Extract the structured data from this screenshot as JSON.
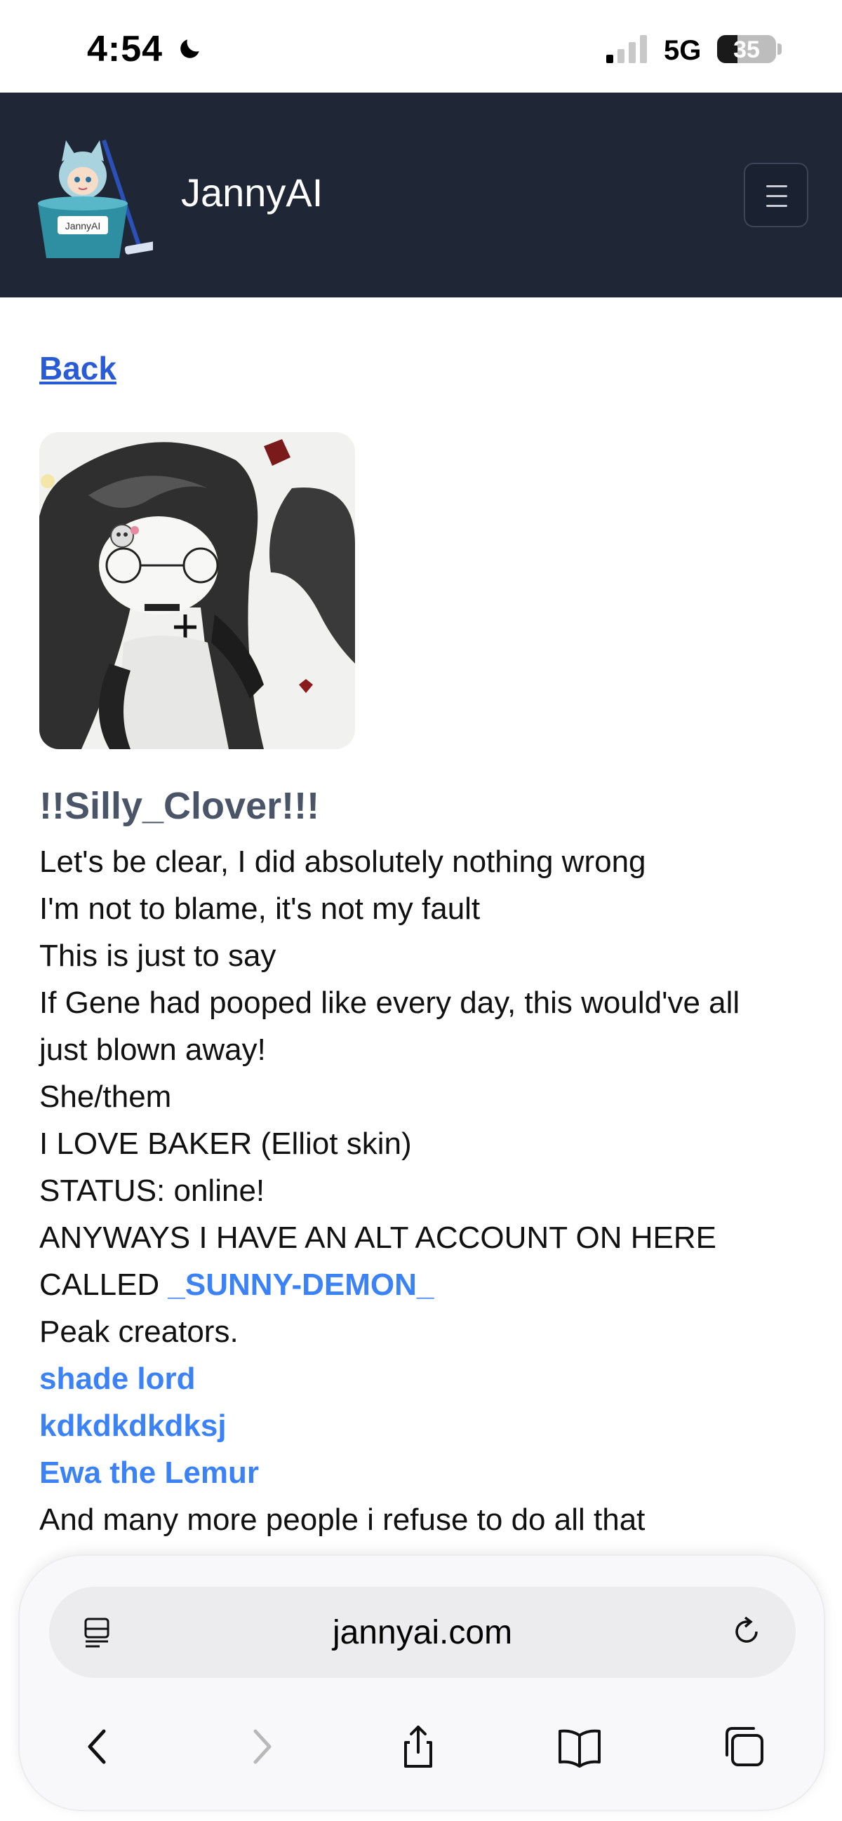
{
  "status_bar": {
    "time": "4:54",
    "network": "5G",
    "battery": "35",
    "battery_level": 0.35
  },
  "header": {
    "site_name": "JannyAI",
    "logo_label": "JannyAI",
    "menu_icon": "hamburger-icon"
  },
  "back_link": "Back",
  "character": {
    "name": "!!Silly_Clover!!!",
    "lines": [
      "Let's be clear, I did absolutely nothing wrong",
      "I'm not to blame, it's not my fault",
      "This is just to say",
      "If Gene had pooped like every day, this would've all",
      "just blown away!",
      "She/them",
      "I LOVE BAKER (Elliot skin)",
      "STATUS: online!",
      "ANYWAYS I HAVE AN ALT ACCOUNT ON HERE"
    ],
    "called_prefix": "CALLED ",
    "alt_account_link": "_SUNNY-DEMON_",
    "peak_creators": "Peak creators.",
    "creator_links": [
      "shade lord",
      "kdkdkdkdksj",
      "Ewa the Lemur"
    ],
    "closing_line": "And many more people i refuse to do all that"
  },
  "browser": {
    "url": "jannyai.com",
    "icons": [
      "reader-icon",
      "reload-icon",
      "back-icon",
      "forward-icon",
      "share-icon",
      "bookmarks-icon",
      "tabs-icon"
    ]
  }
}
